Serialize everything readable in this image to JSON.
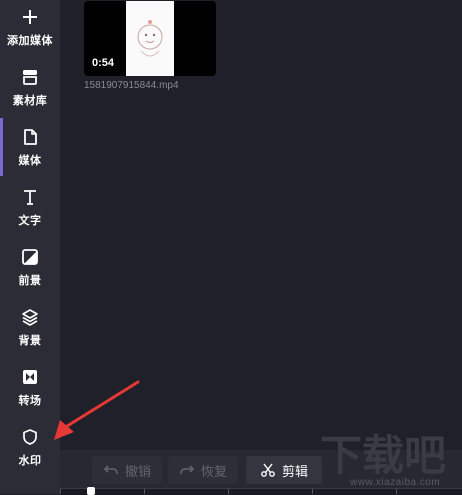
{
  "sidebar": {
    "items": [
      {
        "label": "添加媒体",
        "icon": "plus-icon"
      },
      {
        "label": "素材库",
        "icon": "library-icon"
      },
      {
        "label": "媒体",
        "icon": "file-icon",
        "active": true
      },
      {
        "label": "文字",
        "icon": "text-icon"
      },
      {
        "label": "前景",
        "icon": "foreground-icon"
      },
      {
        "label": "背景",
        "icon": "layers-icon"
      },
      {
        "label": "转场",
        "icon": "transition-icon"
      },
      {
        "label": "水印",
        "icon": "shield-icon"
      }
    ]
  },
  "media": {
    "items": [
      {
        "duration": "0:54",
        "filename": "1581907915844.mp4"
      }
    ]
  },
  "toolbar": {
    "undo_label": "撤销",
    "redo_label": "恢复",
    "cut_label": "剪辑"
  },
  "watermark": {
    "logo_text": "下载吧",
    "site": "www.xiazaiba.com"
  },
  "colors": {
    "accent": "#7c67d6",
    "annotation_arrow": "#e53935"
  }
}
